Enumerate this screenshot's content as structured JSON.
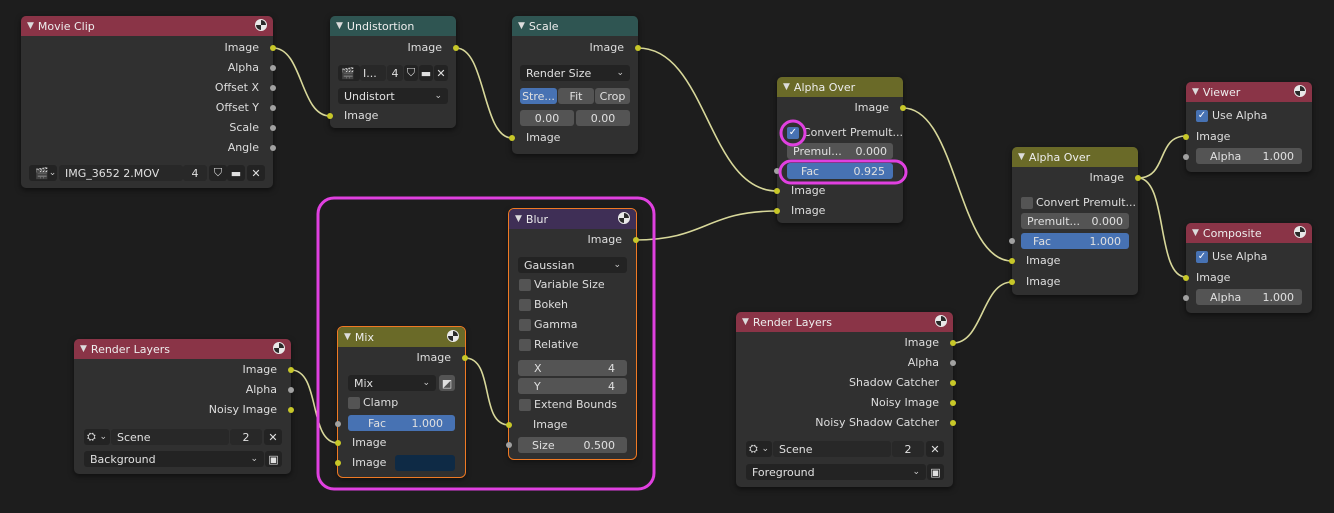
{
  "nodes": {
    "movie_clip": {
      "title": "Movie Clip",
      "outputs": [
        "Image",
        "Alpha",
        "Offset X",
        "Offset Y",
        "Scale",
        "Angle"
      ],
      "clip_name": "IMG_3652 2.MOV",
      "users": "4"
    },
    "undistortion": {
      "title": "Undistortion",
      "output": "Image",
      "clip_name": "I...",
      "users": "4",
      "mode": "Undistort",
      "input": "Image"
    },
    "scale": {
      "title": "Scale",
      "output": "Image",
      "space": "Render Size",
      "fit_options": [
        "Stre...",
        "Fit",
        "Crop"
      ],
      "offset_x": "0.00",
      "offset_y": "0.00",
      "input": "Image"
    },
    "alpha_over_1": {
      "title": "Alpha Over",
      "output": "Image",
      "convert_label": "Convert Premult...",
      "premul_label": "Premul...",
      "premul_value": "0.000",
      "fac_label": "Fac",
      "fac_value": "0.925",
      "inputs": [
        "Image",
        "Image"
      ]
    },
    "alpha_over_2": {
      "title": "Alpha Over",
      "output": "Image",
      "convert_label": "Convert Premult...",
      "premul_label": "Premult...",
      "premul_value": "0.000",
      "fac_label": "Fac",
      "fac_value": "1.000",
      "inputs": [
        "Image",
        "Image"
      ]
    },
    "viewer": {
      "title": "Viewer",
      "use_alpha": "Use Alpha",
      "input": "Image",
      "alpha_label": "Alpha",
      "alpha_value": "1.000"
    },
    "composite": {
      "title": "Composite",
      "use_alpha": "Use Alpha",
      "input": "Image",
      "alpha_label": "Alpha",
      "alpha_value": "1.000"
    },
    "blur": {
      "title": "Blur",
      "output": "Image",
      "filter": "Gaussian",
      "options": [
        "Variable Size",
        "Bokeh",
        "Gamma",
        "Relative"
      ],
      "x_label": "X",
      "x_value": "4",
      "y_label": "Y",
      "y_value": "4",
      "extend_bounds": "Extend Bounds",
      "input": "Image",
      "size_label": "Size",
      "size_value": "0.500"
    },
    "mix": {
      "title": "Mix",
      "output": "Image",
      "blend": "Mix",
      "clamp": "Clamp",
      "fac_label": "Fac",
      "fac_value": "1.000",
      "inputs": [
        "Image",
        "Image"
      ]
    },
    "render_layers_1": {
      "title": "Render Layers",
      "outputs": [
        "Image",
        "Alpha",
        "Noisy Image"
      ],
      "scene": "Scene",
      "users": "2",
      "layer": "Background"
    },
    "render_layers_2": {
      "title": "Render Layers",
      "outputs": [
        "Image",
        "Alpha",
        "Shadow Catcher",
        "Noisy Image",
        "Noisy Shadow Catcher"
      ],
      "scene": "Scene",
      "users": "2",
      "layer": "Foreground"
    }
  },
  "colors": {
    "background": "#1d1d1d",
    "node_body": "#303030",
    "header_input": "#8a3447",
    "header_distort": "#2f5552",
    "header_color": "#6a6a28",
    "header_filter": "#3f2f56",
    "socket_color": "#c7c729",
    "socket_float": "#a1a1a1",
    "wire": "#d8d89a",
    "highlight": "#e040e0",
    "active_field": "#4772b3",
    "selected_outline": "#f07a24"
  },
  "icons": [
    "clapperboard-icon",
    "shield-icon",
    "folder-icon",
    "close-icon",
    "render-icon",
    "chevron-down-icon",
    "checkbox-icon",
    "dropdown-icon",
    "node-type-icon"
  ]
}
